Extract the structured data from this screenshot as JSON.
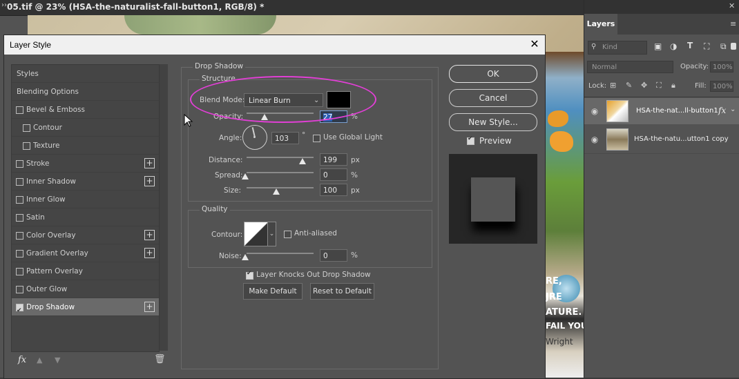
{
  "document": {
    "title": "05.tif @ 23% (HSA-the-naturalist-fall-button1, RGB/8) *",
    "photo_texts": [
      "RE,",
      "JRE",
      "ATURE.",
      "FAIL YOU",
      "Wright"
    ]
  },
  "layers_panel": {
    "tab_label": "Layers",
    "kind_filter": "Kind",
    "blend_mode": "Normal",
    "opacity_label": "Opacity:",
    "opacity_value": "100%",
    "lock_label": "Lock:",
    "fill_label": "Fill:",
    "fill_value": "100%",
    "fx_label": "fx",
    "layers": [
      {
        "name": "HSA-the-nat...ll-button1",
        "selected": true,
        "has_fx": true
      },
      {
        "name": "HSA-the-natu...utton1 copy",
        "selected": false,
        "has_fx": false
      }
    ]
  },
  "dialog": {
    "title": "Layer Style",
    "close_symbol": "✕",
    "styles_list": [
      {
        "label": "Styles",
        "checkbox": false,
        "checked": false,
        "indent": 0,
        "plus": false
      },
      {
        "label": "Blending Options",
        "checkbox": false,
        "checked": false,
        "indent": 0,
        "plus": false
      },
      {
        "label": "Bevel & Emboss",
        "checkbox": true,
        "checked": false,
        "indent": 0,
        "plus": false
      },
      {
        "label": "Contour",
        "checkbox": true,
        "checked": false,
        "indent": 1,
        "plus": false
      },
      {
        "label": "Texture",
        "checkbox": true,
        "checked": false,
        "indent": 1,
        "plus": false
      },
      {
        "label": "Stroke",
        "checkbox": true,
        "checked": false,
        "indent": 0,
        "plus": true
      },
      {
        "label": "Inner Shadow",
        "checkbox": true,
        "checked": false,
        "indent": 0,
        "plus": true
      },
      {
        "label": "Inner Glow",
        "checkbox": true,
        "checked": false,
        "indent": 0,
        "plus": false
      },
      {
        "label": "Satin",
        "checkbox": true,
        "checked": false,
        "indent": 0,
        "plus": false
      },
      {
        "label": "Color Overlay",
        "checkbox": true,
        "checked": false,
        "indent": 0,
        "plus": true
      },
      {
        "label": "Gradient Overlay",
        "checkbox": true,
        "checked": false,
        "indent": 0,
        "plus": true
      },
      {
        "label": "Pattern Overlay",
        "checkbox": true,
        "checked": false,
        "indent": 0,
        "plus": false
      },
      {
        "label": "Outer Glow",
        "checkbox": true,
        "checked": false,
        "indent": 0,
        "plus": false
      },
      {
        "label": "Drop Shadow",
        "checkbox": true,
        "checked": true,
        "indent": 0,
        "plus": true,
        "selected": true
      }
    ],
    "footer_fx": "fx",
    "drop_shadow": {
      "group_title": "Drop Shadow",
      "structure_title": "Structure",
      "blend_mode_label": "Blend Mode:",
      "blend_mode_value": "Linear Burn",
      "shadow_color": "#000000",
      "opacity_label": "Opacity:",
      "opacity_value": "27",
      "opacity_level": 0.27,
      "angle_label": "Angle:",
      "angle_value": "103",
      "angle_unit": "°",
      "use_global_light_label": "Use Global Light",
      "use_global_light": false,
      "distance_label": "Distance:",
      "distance_value": "199",
      "spread_label": "Spread:",
      "spread_value": "0",
      "size_label": "Size:",
      "size_value": "100",
      "unit_percent": "%",
      "unit_px": "px",
      "quality_title": "Quality",
      "contour_label": "Contour:",
      "anti_aliased_label": "Anti-aliased",
      "anti_aliased": false,
      "noise_label": "Noise:",
      "noise_value": "0",
      "knocks_out_label": "Layer Knocks Out Drop Shadow",
      "knocks_out": true,
      "make_default_label": "Make Default",
      "reset_default_label": "Reset to Default"
    },
    "buttons": {
      "ok": "OK",
      "cancel": "Cancel",
      "new_style": "New Style..."
    },
    "preview_label": "Preview",
    "preview_checked": true
  },
  "colors": {
    "highlight": "#e23fd6",
    "panel_bg": "#535353",
    "titlebar_bg": "#f0f0f0"
  }
}
